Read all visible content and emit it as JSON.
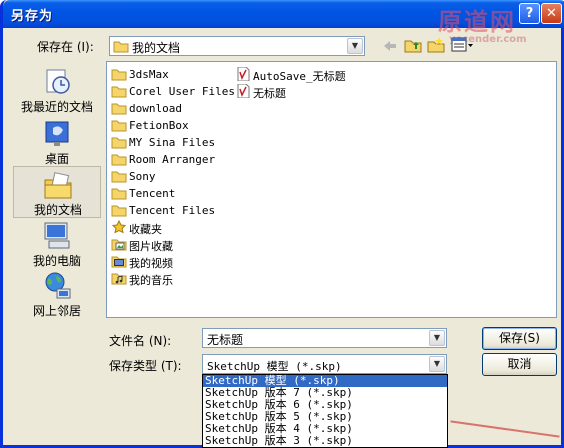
{
  "window": {
    "title": "另存为",
    "watermark_text": "原道网",
    "watermark_url": "yecender.com"
  },
  "savein": {
    "label": "保存在 (I):",
    "value": "我的文档"
  },
  "places": [
    {
      "label": "我最近的文档",
      "icon": "recent-documents-icon"
    },
    {
      "label": "桌面",
      "icon": "desktop-icon"
    },
    {
      "label": "我的文档",
      "icon": "my-documents-icon",
      "selected": true
    },
    {
      "label": "我的电脑",
      "icon": "my-computer-icon"
    },
    {
      "label": "网上邻居",
      "icon": "network-places-icon"
    }
  ],
  "files_col1": [
    {
      "name": "3dsMax",
      "type": "folder"
    },
    {
      "name": "Corel User Files",
      "type": "folder"
    },
    {
      "name": "download",
      "type": "folder"
    },
    {
      "name": "FetionBox",
      "type": "folder"
    },
    {
      "name": "MY Sina Files",
      "type": "folder"
    },
    {
      "name": "Room Arranger",
      "type": "folder"
    },
    {
      "name": "Sony",
      "type": "folder"
    },
    {
      "name": "Tencent",
      "type": "folder"
    },
    {
      "name": "Tencent Files",
      "type": "folder"
    },
    {
      "name": "收藏夹",
      "type": "favorites"
    },
    {
      "name": "图片收藏",
      "type": "pictures"
    },
    {
      "name": "我的视频",
      "type": "videos"
    },
    {
      "name": "我的音乐",
      "type": "music"
    }
  ],
  "files_col2": [
    {
      "name": "AutoSave_无标题",
      "type": "skp"
    },
    {
      "name": "无标题",
      "type": "skp"
    }
  ],
  "filename": {
    "label": "文件名 (N):",
    "value": "无标题"
  },
  "filetype": {
    "label": "保存类型 (T):",
    "value": "SketchUp 模型 (*.skp)",
    "options": [
      "SketchUp 模型 (*.skp)",
      "SketchUp 版本 7 (*.skp)",
      "SketchUp 版本 6 (*.skp)",
      "SketchUp 版本 5 (*.skp)",
      "SketchUp 版本 4 (*.skp)",
      "SketchUp 版本 3 (*.skp)"
    ]
  },
  "buttons": {
    "save": "保存(S)",
    "cancel": "取消"
  },
  "toolbar_icons": [
    "back-icon",
    "up-folder-icon",
    "new-folder-icon",
    "view-menu-icon"
  ]
}
